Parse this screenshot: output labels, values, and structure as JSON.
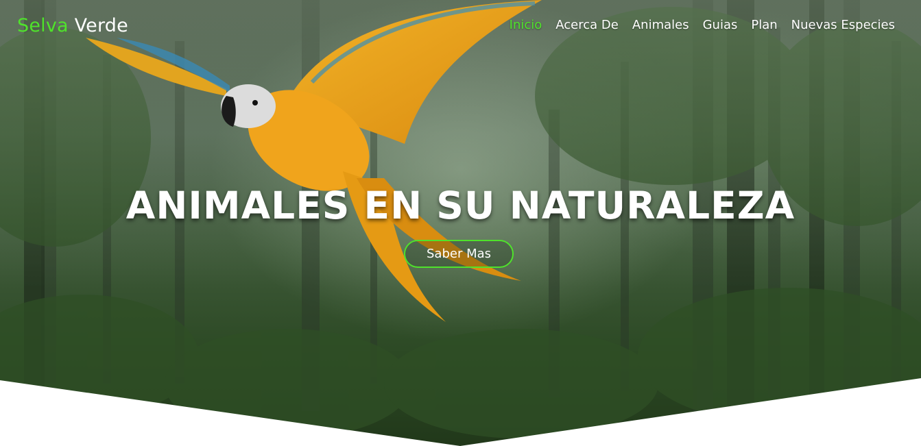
{
  "brand": {
    "accent_text": "Selva",
    "rest_text": "Verde"
  },
  "nav": {
    "items": [
      {
        "label": "Inicio",
        "active": true
      },
      {
        "label": "Acerca De",
        "active": false
      },
      {
        "label": "Animales",
        "active": false
      },
      {
        "label": "Guias",
        "active": false
      },
      {
        "label": "Plan",
        "active": false
      },
      {
        "label": "Nuevas Especies",
        "active": false
      }
    ]
  },
  "hero": {
    "title": "ANIMALES EN SU NATURALEZA",
    "cta_label": "Saber Mas",
    "background_image": "misty-rainforest-with-macaw-photo"
  },
  "colors": {
    "accent": "#4fe32b",
    "text_light": "#ffffff",
    "page_background": "#ffffff"
  }
}
